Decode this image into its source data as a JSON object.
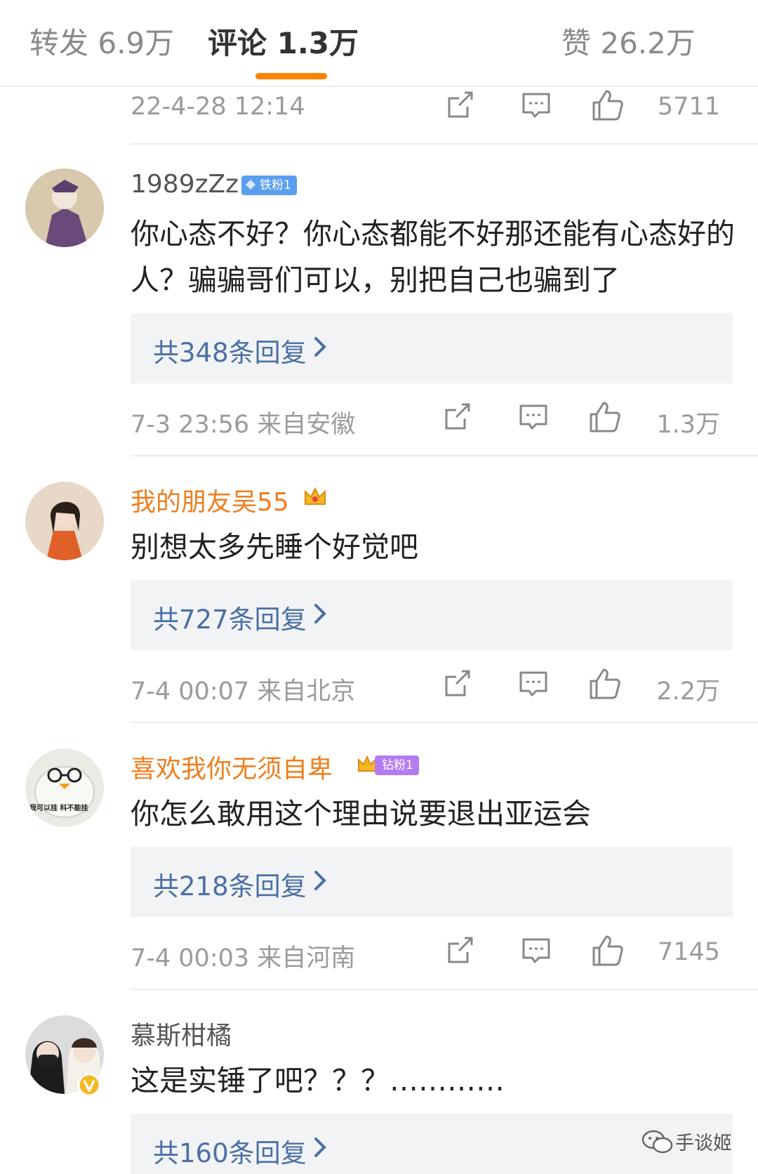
{
  "tabs": {
    "repost": "转发 6.9万",
    "comment": "评论 1.3万",
    "likes": "赞 26.2万"
  },
  "top_meta": {
    "time": "22-4-28 12:14",
    "likes": "5711"
  },
  "comments": [
    {
      "username": "1989zZz",
      "badge": "铁粉1",
      "text": "你心态不好？你心态都能不好那还能有心态好的人？骗骗哥们可以，别把自己也骗到了",
      "replies": "共348条回复",
      "time": "7-3 23:56  来自安徽",
      "likes": "1.3万"
    },
    {
      "username": "我的朋友吴55",
      "text": "别想太多先睡个好觉吧",
      "replies": "共727条回复",
      "time": "7-4 00:07  来自北京",
      "likes": "2.2万"
    },
    {
      "username": "喜欢我你无须自卑",
      "badge": "钻粉1",
      "avatar_text": "我可以挂 科不能挂",
      "text": "你怎么敢用这个理由说要退出亚运会",
      "replies": "共218条回复",
      "time": "7-4 00:03  来自河南",
      "likes": "7145"
    },
    {
      "username": "慕斯柑橘",
      "text": "这是实锤了吧？？？…………",
      "replies": "共160条回复"
    }
  ],
  "watermark": "手谈姬",
  "colors": {
    "accent": "#ff8200",
    "vip_name": "#f07e1e",
    "reply_link": "#4a6fa5",
    "iron_badge": "#5a9ef0",
    "diamond_badge": "#b57bf0",
    "verified": "#f5b824"
  }
}
